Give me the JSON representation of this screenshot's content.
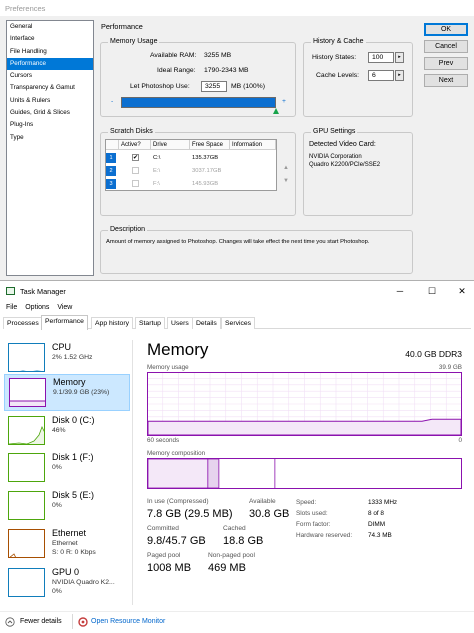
{
  "preferences": {
    "title": "Preferences",
    "sidebar": [
      "General",
      "Interface",
      "File Handling",
      "Performance",
      "Cursors",
      "Transparency & Gamut",
      "Units & Rulers",
      "Guides, Grid & Slices",
      "Plug-Ins",
      "Type"
    ],
    "selected_index": 3,
    "section_title": "Performance",
    "memory_usage": {
      "legend": "Memory Usage",
      "available_ram_label": "Available RAM:",
      "available_ram_value": "3255 MB",
      "ideal_range_label": "Ideal Range:",
      "ideal_range_value": "1790-2343 MB",
      "let_use_label": "Let Photoshop Use:",
      "let_use_value": "3255",
      "let_use_unit": "MB (100%)",
      "minus": "-",
      "plus": "+",
      "slider_fraction": 1.0
    },
    "history_cache": {
      "legend": "History & Cache",
      "history_states_label": "History States:",
      "history_states_value": "100",
      "cache_levels_label": "Cache Levels:",
      "cache_levels_value": "6"
    },
    "scratch_disks": {
      "legend": "Scratch Disks",
      "columns": [
        "Active?",
        "Drive",
        "Free Space",
        "Information"
      ],
      "rows": [
        {
          "num": "1",
          "active": true,
          "check": "✔",
          "drive": "C:\\",
          "free": "135.37GB",
          "info": "",
          "enabled": true
        },
        {
          "num": "2",
          "active": false,
          "check": "",
          "drive": "E:\\",
          "free": "3037.17GB",
          "info": "",
          "enabled": false
        },
        {
          "num": "3",
          "active": false,
          "check": "",
          "drive": "F:\\",
          "free": "145.93GB",
          "info": "",
          "enabled": false
        }
      ],
      "up_arrow": "▲",
      "down_arrow": "▼"
    },
    "gpu": {
      "legend": "GPU Settings",
      "detected_label": "Detected Video Card:",
      "card_line1": "NVIDIA Corporation",
      "card_line2": "Quadro K2200/PCIe/SSE2"
    },
    "description": {
      "legend": "Description",
      "text": "Amount of memory assigned to Photoshop. Changes will take effect the next time you start Photoshop."
    },
    "buttons": {
      "ok": "OK",
      "cancel": "Cancel",
      "prev": "Prev",
      "next": "Next"
    }
  },
  "task_manager": {
    "title": "Task Manager",
    "window_buttons": {
      "minimize": "─",
      "maximize": "☐",
      "close": "✕"
    },
    "menu": [
      "File",
      "Options",
      "View"
    ],
    "tabs": [
      "Processes",
      "Performance",
      "App history",
      "Startup",
      "Users",
      "Details",
      "Services"
    ],
    "active_tab": 1,
    "resources": [
      {
        "name": "CPU",
        "sub": "2% 1.52 GHz",
        "sub2": "",
        "color": "#117dbb",
        "selected": false
      },
      {
        "name": "Memory",
        "sub": "9.1/39.9 GB (23%)",
        "sub2": "",
        "color": "#8b12ae",
        "selected": true
      },
      {
        "name": "Disk 0 (C:)",
        "sub": "46%",
        "sub2": "",
        "color": "#4da60c",
        "selected": false
      },
      {
        "name": "Disk 1 (F:)",
        "sub": "0%",
        "sub2": "",
        "color": "#4da60c",
        "selected": false
      },
      {
        "name": "Disk 5 (E:)",
        "sub": "0%",
        "sub2": "",
        "color": "#4da60c",
        "selected": false
      },
      {
        "name": "Ethernet",
        "sub": "Ethernet",
        "sub2": "S: 0 R: 0 Kbps",
        "color": "#a74f01",
        "selected": false
      },
      {
        "name": "GPU 0",
        "sub": "NVIDIA Quadro K2...",
        "sub2": "0%",
        "color": "#117dbb",
        "selected": false
      }
    ],
    "memory": {
      "title": "Memory",
      "model": "40.0 GB DDR3",
      "usage_label": "Memory usage",
      "usage_max": "39.9 GB",
      "time_left": "60 seconds",
      "time_right": "0",
      "composition_label": "Memory composition",
      "usage_fraction": 0.23,
      "composition_in_use_fraction": 0.19,
      "composition_modified_fraction": 0.035,
      "stats": {
        "in_use_label": "In use (Compressed)",
        "in_use_value": "7.8 GB (29.5 MB)",
        "available_label": "Available",
        "available_value": "30.8 GB",
        "committed_label": "Committed",
        "committed_value": "9.8/45.7 GB",
        "cached_label": "Cached",
        "cached_value": "18.8 GB",
        "paged_label": "Paged pool",
        "paged_value": "1008 MB",
        "nonpaged_label": "Non-paged pool",
        "nonpaged_value": "469 MB"
      },
      "specs": [
        {
          "key": "Speed:",
          "value": "1333 MHz"
        },
        {
          "key": "Slots used:",
          "value": "8 of 8"
        },
        {
          "key": "Form factor:",
          "value": "DIMM"
        },
        {
          "key": "Hardware reserved:",
          "value": "74.3 MB"
        }
      ]
    },
    "footer": {
      "fewer_details": "Fewer details",
      "open_monitor": "Open Resource Monitor"
    },
    "colors": {
      "accent": "#8b12ae",
      "link": "#0066cc",
      "selection": "#cce8ff"
    }
  }
}
